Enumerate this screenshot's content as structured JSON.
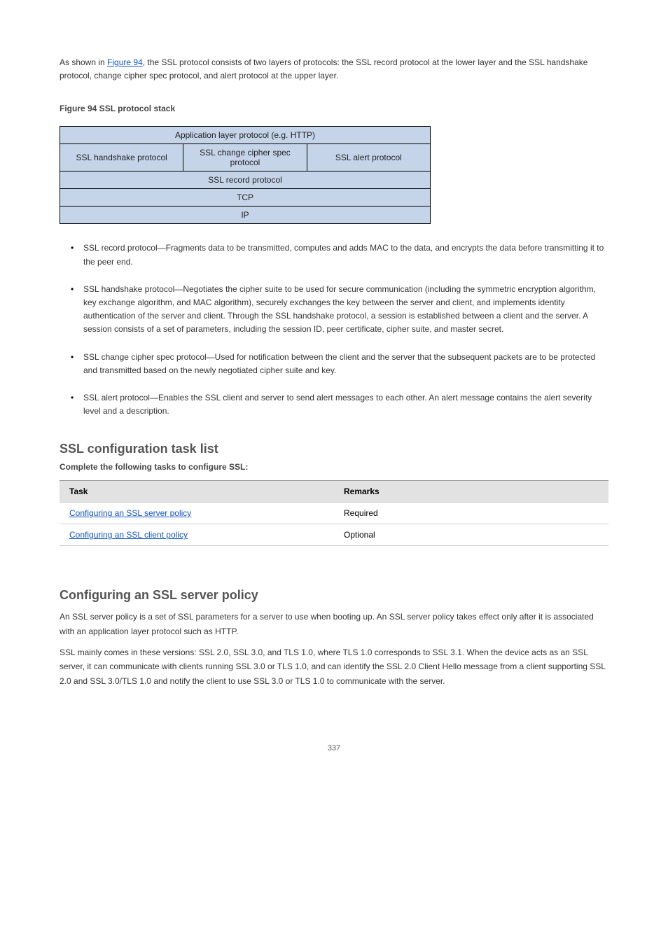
{
  "intro": {
    "text_before_link": "As shown in ",
    "link_text": "Figure 94",
    "text_after_link": ", the SSL protocol consists of two layers of protocols: the SSL record protocol at the lower layer and the SSL handshake protocol, change cipher spec protocol, and alert protocol at the upper layer."
  },
  "figure": {
    "caption": "Figure 94 SSL protocol stack",
    "rows": {
      "app_layer": "Application layer protocol (e.g. HTTP)",
      "handshake": "SSL handshake protocol",
      "change_cipher": "SSL change cipher spec protocol",
      "alert": "SSL alert protocol",
      "record": "SSL record protocol",
      "tcp": "TCP",
      "ip": "IP"
    }
  },
  "bullets": [
    "SSL record protocol—Fragments data to be transmitted, computes and adds MAC to the data, and encrypts the data before transmitting it to the peer end.",
    "SSL handshake protocol—Negotiates the cipher suite to be used for secure communication (including the symmetric encryption algorithm, key exchange algorithm, and MAC algorithm), securely exchanges the key between the server and client, and implements identity authentication of the server and client. Through the SSL handshake protocol, a session is established between a client and the server. A session consists of a set of parameters, including the session ID, peer certificate, cipher suite, and master secret.",
    "SSL change cipher spec protocol—Used for notification between the client and the server that the subsequent packets are to be protected and transmitted based on the newly negotiated cipher suite and key.",
    "SSL alert protocol—Enables the SSL client and server to send alert messages to each other. An alert message contains the alert severity level and a description."
  ],
  "tasks_section": {
    "heading": "SSL configuration task list",
    "label": "Complete the following tasks to configure SSL:",
    "columns": {
      "task": "Task",
      "remarks": "Remarks"
    },
    "rows": [
      {
        "task": "Configuring an SSL server policy",
        "remarks": "Required"
      },
      {
        "task": "Configuring an SSL client policy",
        "remarks": "Optional"
      }
    ]
  },
  "server_policy": {
    "heading": "Configuring an SSL server policy",
    "p1": "An SSL server policy is a set of SSL parameters for a server to use when booting up. An SSL server policy takes effect only after it is associated with an application layer protocol such as HTTP.",
    "p2": "SSL mainly comes in these versions: SSL 2.0, SSL 3.0, and TLS 1.0, where TLS 1.0 corresponds to SSL 3.1. When the device acts as an SSL server, it can communicate with clients running SSL 3.0 or TLS 1.0, and can identify the SSL 2.0 Client Hello message from a client supporting SSL 2.0 and SSL 3.0/TLS 1.0 and notify the client to use SSL 3.0 or TLS 1.0 to communicate with the server."
  },
  "page_number": "337"
}
